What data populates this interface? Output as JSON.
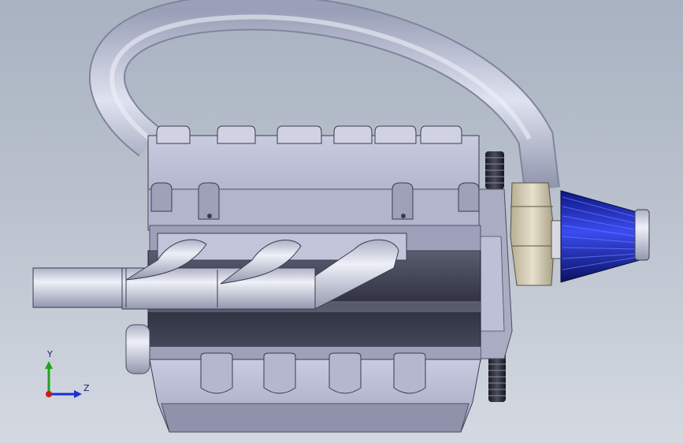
{
  "viewport": {
    "background_top": "#a9b2c1",
    "background_bottom": "#d4d9e1",
    "model_color": "#c7c9df",
    "filter_color": "#1f2fd0"
  },
  "triad": {
    "y_label": "Y",
    "z_label": "Z",
    "y_color": "#1fa31f",
    "z_color": "#1a2fd6",
    "x_color": "#d01818"
  }
}
